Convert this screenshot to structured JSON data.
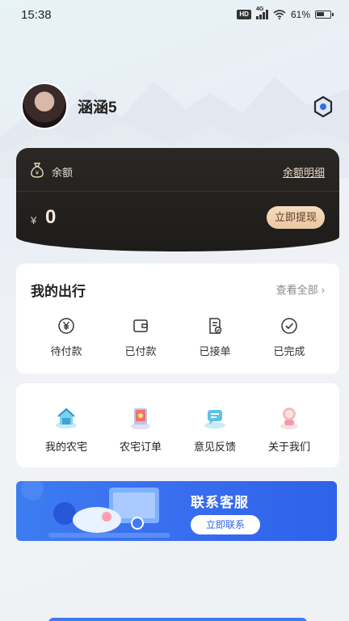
{
  "status_bar": {
    "time": "15:38",
    "hd_badge": "HD",
    "network": "4G",
    "battery_percent": "61%",
    "battery_level": 0.61
  },
  "profile": {
    "username": "涵涵5",
    "settings_icon": "settings-hex-icon"
  },
  "balance": {
    "label": "余额",
    "detail_link": "余额明细",
    "currency": "¥",
    "value": "0",
    "withdraw_button": "立即提现",
    "icon": "money-bag-icon"
  },
  "trips": {
    "title": "我的出行",
    "view_all": "查看全部",
    "items": [
      {
        "label": "待付款",
        "icon": "yen-pending-icon"
      },
      {
        "label": "已付款",
        "icon": "wallet-icon"
      },
      {
        "label": "已接单",
        "icon": "document-check-icon"
      },
      {
        "label": "已完成",
        "icon": "check-circle-icon"
      }
    ]
  },
  "menu": {
    "items": [
      {
        "label": "我的农宅",
        "icon": "house-icon"
      },
      {
        "label": "农宅订单",
        "icon": "order-icon"
      },
      {
        "label": "意见反馈",
        "icon": "feedback-icon"
      },
      {
        "label": "关于我们",
        "icon": "astronaut-icon"
      }
    ]
  },
  "banner": {
    "title": "联系客服",
    "button": "立即联系"
  },
  "colors": {
    "card_dark": "#1e1c1a",
    "gold_button": "#e9c7a2",
    "banner_blue": "#3a6ff0"
  }
}
